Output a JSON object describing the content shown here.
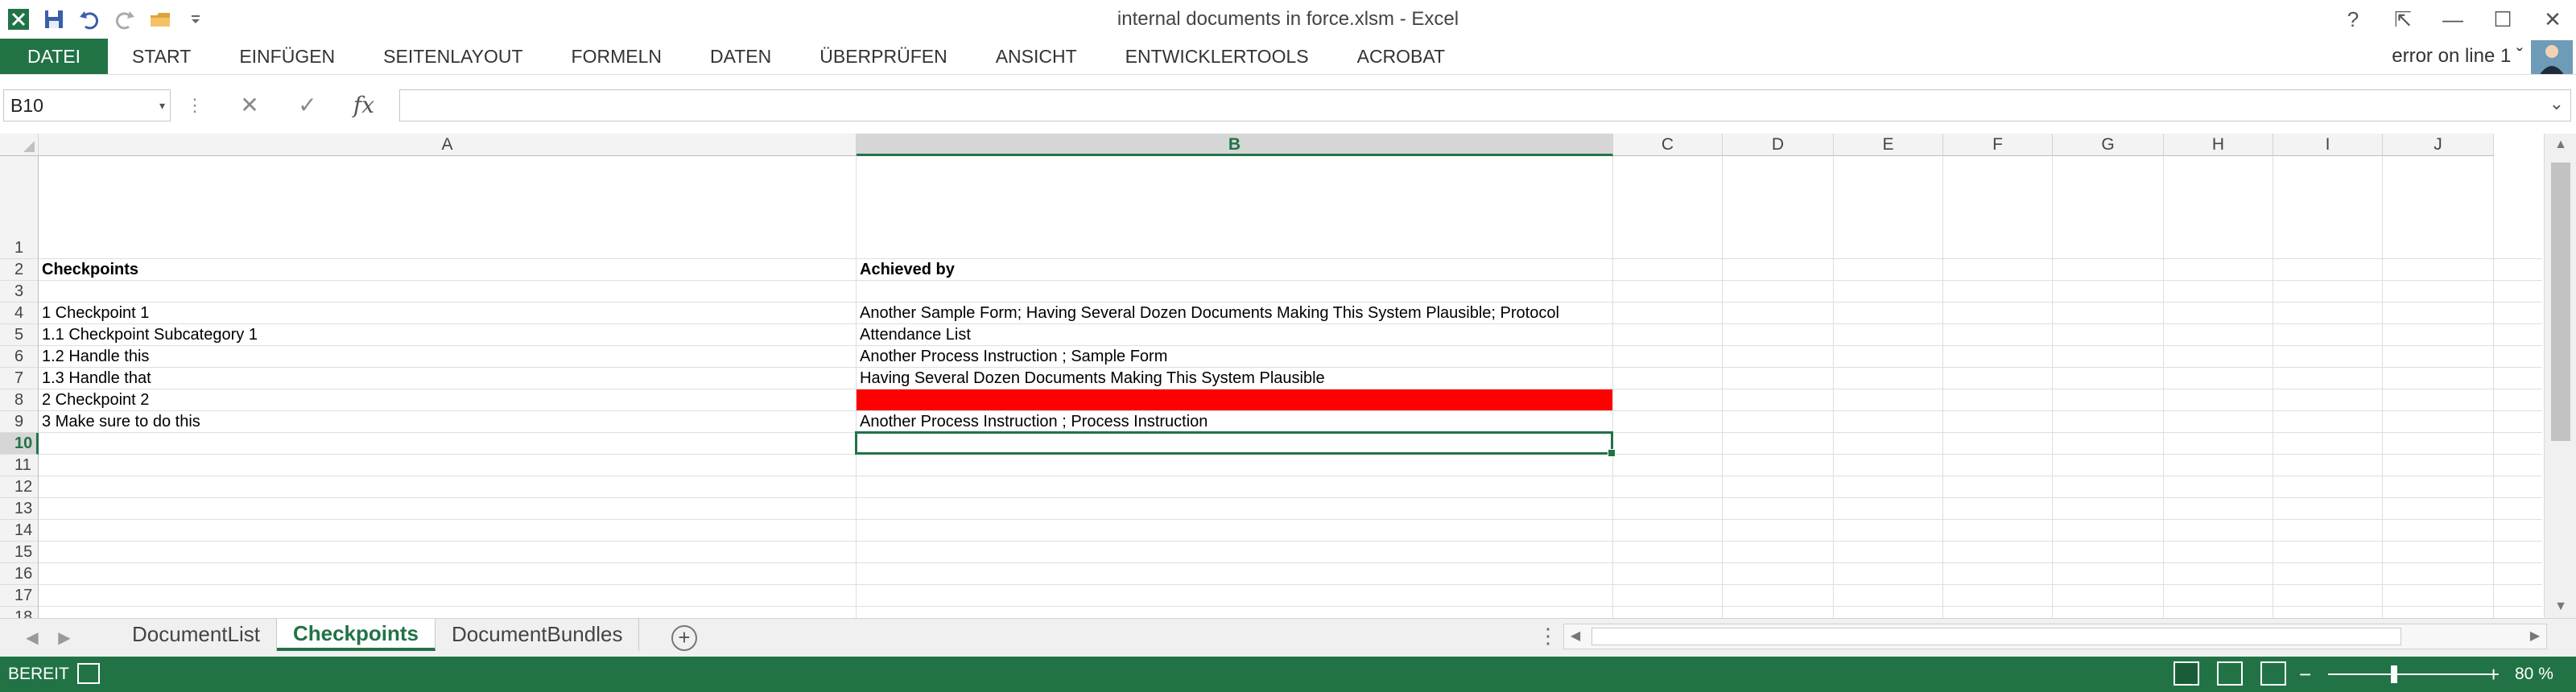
{
  "window": {
    "title": "internal documents in force.xlsm - Excel",
    "controls": {
      "help": "?",
      "restore_ribbon": "⇱",
      "minimize": "—",
      "maximize": "☐",
      "close": "✕"
    }
  },
  "ribbon": {
    "tabs": [
      "DATEI",
      "START",
      "EINFÜGEN",
      "SEITENLAYOUT",
      "FORMELN",
      "DATEN",
      "ÜBERPRÜFEN",
      "ANSICHT",
      "ENTWICKLERTOOLS",
      "ACROBAT"
    ],
    "user": "error on line 1 ˇ"
  },
  "formula_bar": {
    "name_box": "B10",
    "name_box_dropdown": "▾",
    "more": "⋮",
    "cancel": "✕",
    "enter": "✓",
    "fx": "fx",
    "formula": "",
    "expand": "⌄"
  },
  "grid": {
    "columns": [
      "A",
      "B",
      "C",
      "D",
      "E",
      "F",
      "G",
      "H",
      "I",
      "J"
    ],
    "selected_column": "B",
    "rows": [
      "1",
      "2",
      "3",
      "4",
      "5",
      "6",
      "7",
      "8",
      "9",
      "10",
      "11",
      "12",
      "13",
      "14",
      "15",
      "16",
      "17",
      "18"
    ],
    "selected_row": "10",
    "cells": {
      "A2": "Checkpoints",
      "B2": "Achieved by",
      "A4": "1 Checkpoint 1",
      "B4": "Another Sample Form; Having Several Dozen Documents Making This System Plausible; Protocol",
      "A5": "1.1 Checkpoint Subcategory 1",
      "B5": "Attendance List",
      "A6": "1.2 Handle this",
      "B6": "Another Process Instruction ; Sample Form",
      "A7": "1.3 Handle that",
      "B7": "Having Several Dozen Documents Making This System Plausible",
      "A8": "2 Checkpoint 2",
      "B8": "",
      "A9": "3 Make sure to do this",
      "B9": "Another Process Instruction ; Process Instruction"
    },
    "fill_colors": {
      "B8": "#ff0000"
    },
    "active_cell": "B10"
  },
  "sheet_tabs": {
    "tabs": [
      "DocumentList",
      "Checkpoints",
      "DocumentBundles"
    ],
    "active": "Checkpoints",
    "prev": "◀",
    "next": "▶",
    "add": "+",
    "more": "⋮"
  },
  "status_bar": {
    "status": "BEREIT",
    "zoom_out": "−",
    "zoom_in": "+",
    "zoom_level": "80 %",
    "zoom_fraction": 0.8
  },
  "colors": {
    "accent": "#217346",
    "fill_red": "#ff0000"
  }
}
